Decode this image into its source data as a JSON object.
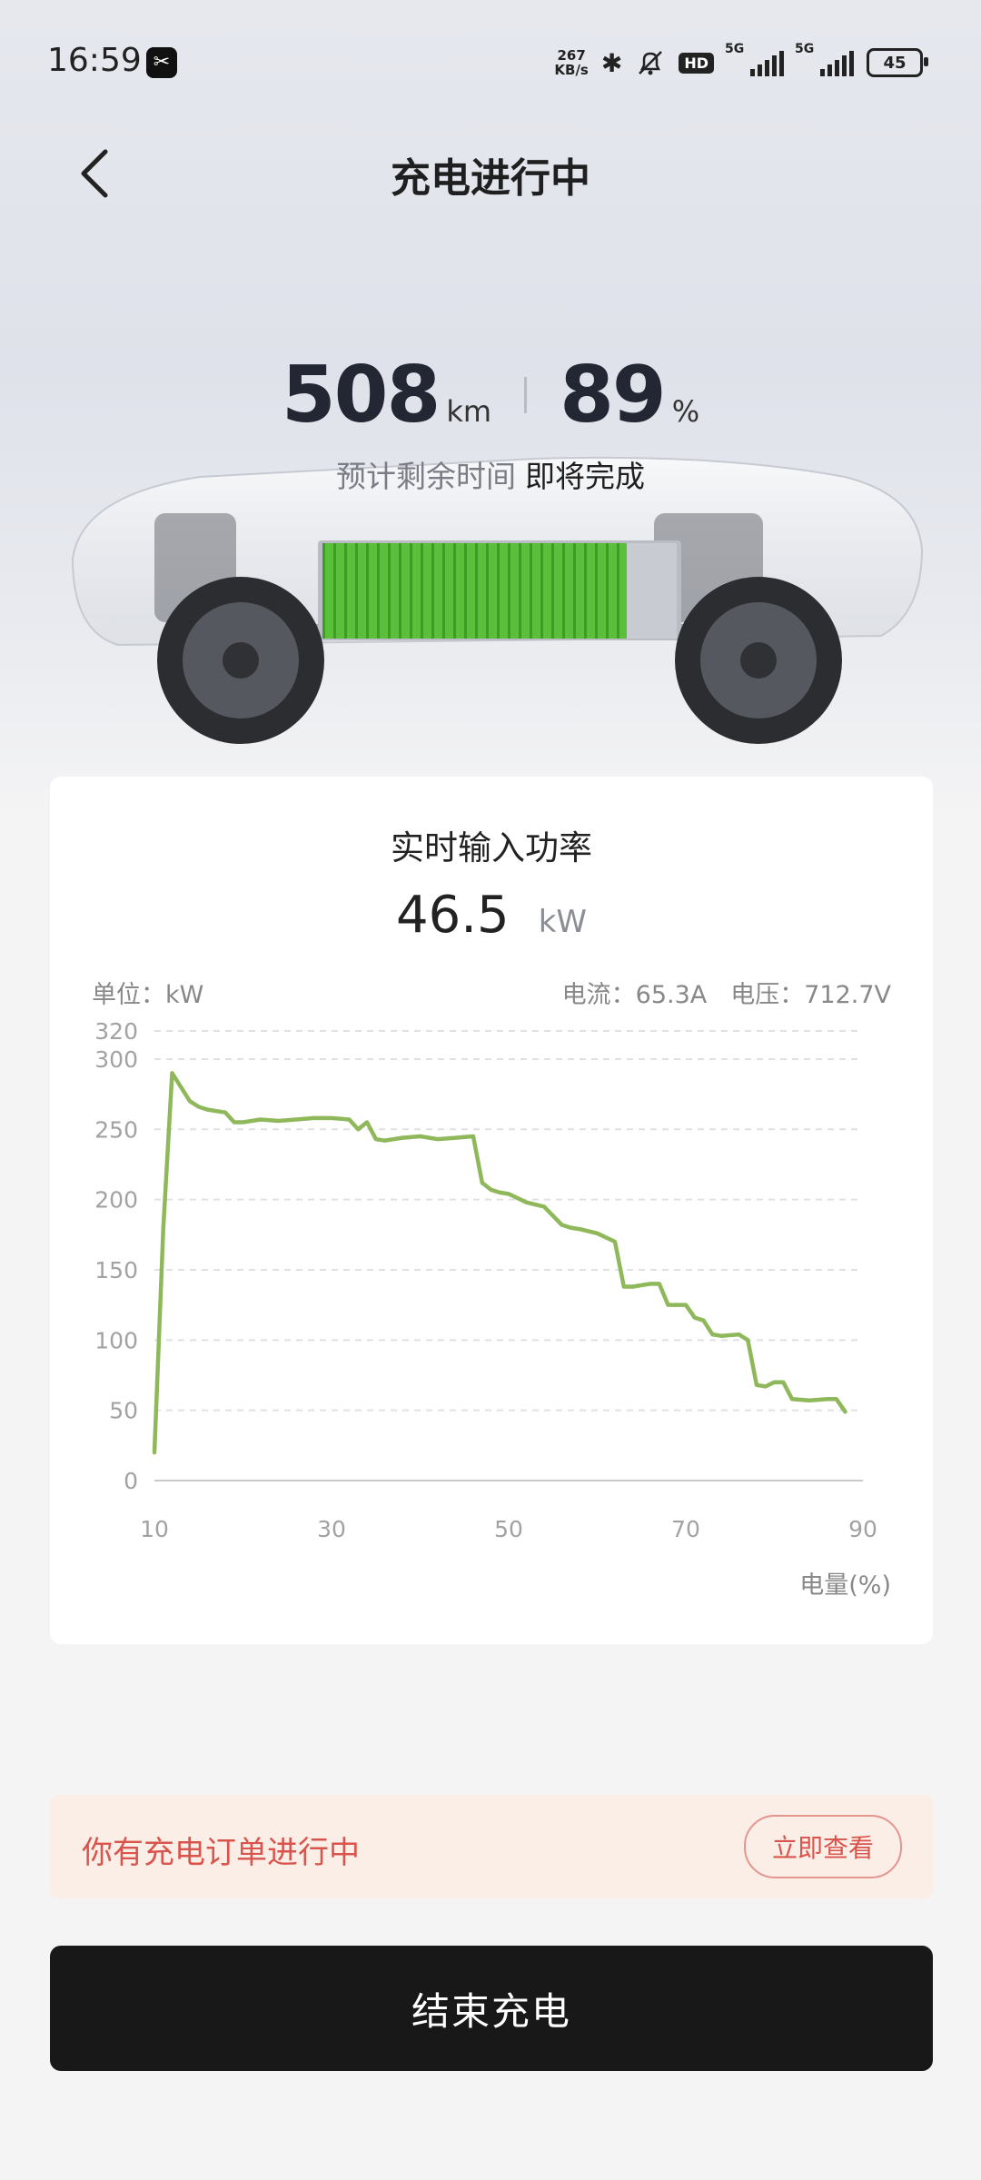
{
  "status_bar": {
    "time": "16:59",
    "net_speed_value": "267",
    "net_speed_unit": "KB/s",
    "hd_label": "HD",
    "sim1_label": "5G",
    "sim2_label": "5G",
    "battery_level": "45"
  },
  "header": {
    "title": "充电进行中"
  },
  "stats": {
    "range_value": "508",
    "range_unit": "km",
    "soc_value": "89",
    "soc_unit": "%",
    "eta_label": "预计剩余时间",
    "eta_value": "即将完成"
  },
  "power_card": {
    "title": "实时输入功率",
    "power_value": "46.5",
    "power_unit": "kW",
    "unit_label": "单位：kW",
    "current_label": "电流：65.3A",
    "voltage_label": "电压：712.7V"
  },
  "chart_data": {
    "type": "line",
    "title": "实时输入功率",
    "xlabel": "电量(%)",
    "ylabel": "单位：kW",
    "xlim": [
      10,
      90
    ],
    "ylim": [
      0,
      320
    ],
    "x_ticks": [
      10,
      30,
      50,
      70,
      90
    ],
    "y_ticks": [
      0,
      50,
      100,
      150,
      200,
      250,
      300,
      320
    ],
    "grid": true,
    "color": "#8fb85b",
    "series": [
      {
        "x": [
          10,
          11,
          12,
          13,
          14,
          15,
          16,
          17,
          18,
          19,
          20,
          22,
          24,
          26,
          28,
          30,
          32,
          33,
          34,
          35,
          36,
          38,
          40,
          42,
          44,
          46,
          47,
          48,
          49,
          50,
          52,
          54,
          56,
          57,
          58,
          60,
          62,
          63,
          64,
          66,
          67,
          68,
          69,
          70,
          71,
          72,
          73,
          74,
          76,
          77,
          78,
          79,
          80,
          81,
          82,
          84,
          86,
          87,
          88
        ],
        "y": [
          20,
          180,
          290,
          280,
          270,
          266,
          264,
          263,
          262,
          255,
          255,
          257,
          256,
          257,
          258,
          258,
          257,
          250,
          255,
          243,
          242,
          244,
          245,
          243,
          244,
          245,
          212,
          207,
          205,
          204,
          198,
          195,
          182,
          180,
          179,
          176,
          170,
          138,
          138,
          140,
          140,
          125,
          125,
          125,
          116,
          114,
          104,
          103,
          104,
          100,
          68,
          67,
          70,
          70,
          58,
          57,
          58,
          58,
          49
        ]
      }
    ]
  },
  "order_banner": {
    "text": "你有充电订单进行中",
    "button_label": "立即查看"
  },
  "footer": {
    "end_label": "结束充电"
  }
}
